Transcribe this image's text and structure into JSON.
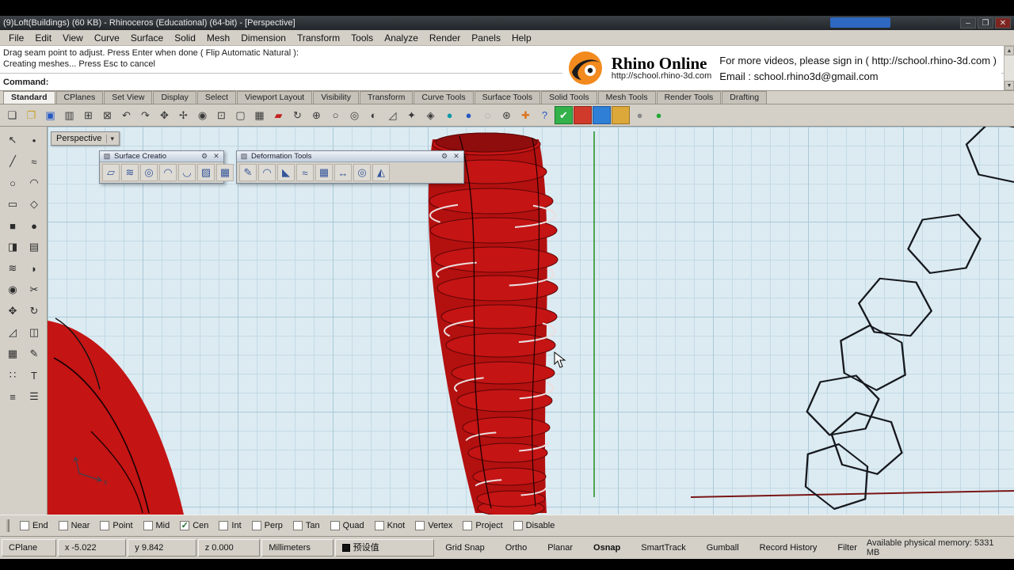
{
  "window": {
    "title": "(9)Loft(Buildings) (60 KB) - Rhinoceros (Educational) (64-bit) - [Perspective]",
    "minimize": "–",
    "maximize": "❐",
    "close": "✕"
  },
  "menu_bar": {
    "items": [
      {
        "name": "menu-file",
        "label": "File"
      },
      {
        "name": "menu-edit",
        "label": "Edit"
      },
      {
        "name": "menu-view",
        "label": "View"
      },
      {
        "name": "menu-curve",
        "label": "Curve"
      },
      {
        "name": "menu-surface",
        "label": "Surface"
      },
      {
        "name": "menu-solid",
        "label": "Solid"
      },
      {
        "name": "menu-mesh",
        "label": "Mesh"
      },
      {
        "name": "menu-dimension",
        "label": "Dimension"
      },
      {
        "name": "menu-transform",
        "label": "Transform"
      },
      {
        "name": "menu-tools",
        "label": "Tools"
      },
      {
        "name": "menu-analyze",
        "label": "Analyze"
      },
      {
        "name": "menu-render",
        "label": "Render"
      },
      {
        "name": "menu-panels",
        "label": "Panels"
      },
      {
        "name": "menu-help",
        "label": "Help"
      }
    ]
  },
  "command_area": {
    "history_line1": "Drag seam point to adjust. Press Enter when done ( Flip  Automatic  Natural ):",
    "history_line2": "Creating meshes... Press Esc to cancel",
    "prompt_label": "Command:",
    "scroll_up": "▲",
    "scroll_down": "▼"
  },
  "ad_banner": {
    "brand": "Rhino Online",
    "brand_url": "http://school.rhino-3d.com",
    "message": "For more videos, please  sign in ( http://school.rhino-3d.com )",
    "email_line": "Email : school.rhino3d@gmail.com"
  },
  "toolbar_tabs": {
    "items": [
      {
        "name": "tab-standard",
        "label": "Standard",
        "active": true
      },
      {
        "name": "tab-cplanes",
        "label": "CPlanes"
      },
      {
        "name": "tab-set-view",
        "label": "Set View"
      },
      {
        "name": "tab-display",
        "label": "Display"
      },
      {
        "name": "tab-select",
        "label": "Select"
      },
      {
        "name": "tab-viewport-layout",
        "label": "Viewport Layout"
      },
      {
        "name": "tab-visibility",
        "label": "Visibility"
      },
      {
        "name": "tab-transform",
        "label": "Transform"
      },
      {
        "name": "tab-curve-tools",
        "label": "Curve Tools"
      },
      {
        "name": "tab-surface-tools",
        "label": "Surface Tools"
      },
      {
        "name": "tab-solid-tools",
        "label": "Solid Tools"
      },
      {
        "name": "tab-mesh-tools",
        "label": "Mesh Tools"
      },
      {
        "name": "tab-render-tools",
        "label": "Render Tools"
      },
      {
        "name": "tab-drafting",
        "label": "Drafting"
      }
    ]
  },
  "main_toolbar": {
    "icons": [
      {
        "name": "new-file-icon",
        "glyph": "❏"
      },
      {
        "name": "open-file-icon",
        "glyph": "❐",
        "variant": "yellow"
      },
      {
        "name": "save-icon",
        "glyph": "▣",
        "variant": "blue"
      },
      {
        "name": "print-icon",
        "glyph": "▥"
      },
      {
        "name": "copy-icon",
        "glyph": "⊞"
      },
      {
        "name": "paste-icon",
        "glyph": "⊠"
      },
      {
        "name": "undo-icon",
        "glyph": "↶"
      },
      {
        "name": "redo-icon",
        "glyph": "↷"
      },
      {
        "name": "pan-icon",
        "glyph": "✥"
      },
      {
        "name": "move-icon",
        "glyph": "✢"
      },
      {
        "name": "zoom-dynamic-icon",
        "glyph": "◉"
      },
      {
        "name": "zoom-window-icon",
        "glyph": "⊡"
      },
      {
        "name": "zoom-extents-icon",
        "glyph": "▢"
      },
      {
        "name": "zoom-selected-icon",
        "glyph": "▦"
      },
      {
        "name": "named-view-icon",
        "glyph": "▰",
        "variant": "red"
      },
      {
        "name": "rotate-view-icon",
        "glyph": "↻"
      },
      {
        "name": "copy-object-icon",
        "glyph": "⊕"
      },
      {
        "name": "circle-tool-icon",
        "glyph": "○"
      },
      {
        "name": "spiral-tool-icon",
        "glyph": "◎"
      },
      {
        "name": "shade-icon",
        "glyph": "◐"
      },
      {
        "name": "scale-icon",
        "glyph": "◿"
      },
      {
        "name": "key-icon",
        "glyph": "✦"
      },
      {
        "name": "lock-icon",
        "glyph": "◈"
      },
      {
        "name": "render-icon",
        "glyph": "●",
        "variant": "teal"
      },
      {
        "name": "render-preview-icon",
        "glyph": "●",
        "variant": "blue"
      },
      {
        "name": "wireframe-icon",
        "glyph": "◌",
        "variant": "gray"
      },
      {
        "name": "settings-icon",
        "glyph": "⊛"
      },
      {
        "name": "add-icon",
        "glyph": "✚",
        "variant": "orange"
      },
      {
        "name": "help-icon",
        "glyph": "?",
        "variant": "blue"
      },
      {
        "name": "check-tile-icon",
        "glyph": "✔",
        "variant": "green-tile"
      },
      {
        "name": "red-tile-icon",
        "glyph": " ",
        "variant": "red-tile"
      },
      {
        "name": "blue-tile-icon",
        "glyph": " ",
        "variant": "blue-tile"
      },
      {
        "name": "amber-tile-icon",
        "glyph": " ",
        "variant": "amber-tile"
      },
      {
        "name": "gray-ball-icon",
        "glyph": "●",
        "variant": "gray"
      },
      {
        "name": "green-ball-icon",
        "glyph": "●",
        "variant": "green"
      }
    ]
  },
  "side_toolbar": {
    "icons": [
      {
        "name": "select-arrow-icon",
        "glyph": "↖"
      },
      {
        "name": "point-icon",
        "glyph": "•"
      },
      {
        "name": "line-icon",
        "glyph": "╱"
      },
      {
        "name": "curve-icon",
        "glyph": "≈"
      },
      {
        "name": "circle-icon",
        "glyph": "○"
      },
      {
        "name": "arc-icon",
        "glyph": "◠"
      },
      {
        "name": "rectangle-icon",
        "glyph": "▭"
      },
      {
        "name": "polygon-icon",
        "glyph": "◇"
      },
      {
        "name": "box-icon",
        "glyph": "■",
        "variant": "blue"
      },
      {
        "name": "sphere-icon",
        "glyph": "●",
        "variant": "blue"
      },
      {
        "name": "extrude-icon",
        "glyph": "◨"
      },
      {
        "name": "surface-icon",
        "glyph": "▤"
      },
      {
        "name": "loft-icon",
        "glyph": "≋"
      },
      {
        "name": "fillet-icon",
        "glyph": "◗",
        "variant": "red"
      },
      {
        "name": "boolean-icon",
        "glyph": "◉",
        "variant": "gray"
      },
      {
        "name": "trim-icon",
        "glyph": "✂"
      },
      {
        "name": "move-object-icon",
        "glyph": "✥"
      },
      {
        "name": "rotate-object-icon",
        "glyph": "↻"
      },
      {
        "name": "scale-object-icon",
        "glyph": "◿"
      },
      {
        "name": "mirror-icon",
        "glyph": "◫"
      },
      {
        "name": "array-icon",
        "glyph": "▦"
      },
      {
        "name": "curve-edit-icon",
        "glyph": "✎"
      },
      {
        "name": "control-points-icon",
        "glyph": "∷"
      },
      {
        "name": "text-icon",
        "glyph": "T"
      },
      {
        "name": "layers-icon",
        "glyph": "≡"
      },
      {
        "name": "properties-icon",
        "glyph": "☰"
      }
    ]
  },
  "viewport": {
    "view_label": "Perspective",
    "dropdown_arrow": "▾"
  },
  "palettes": {
    "surface": {
      "panel_icon": "▨",
      "title": "Surface Creatio",
      "gear": "⚙",
      "close": "✕",
      "overflow": "»",
      "icons": [
        {
          "name": "srf-3pt-icon",
          "glyph": "▱"
        },
        {
          "name": "loft-tool-icon",
          "glyph": "≋"
        },
        {
          "name": "revolve-icon",
          "glyph": "◎"
        },
        {
          "name": "sweep1-icon",
          "glyph": "◠"
        },
        {
          "name": "sweep2-icon",
          "glyph": "◡"
        },
        {
          "name": "patch-icon",
          "glyph": "▨"
        },
        {
          "name": "network-srf-icon",
          "glyph": "▦"
        }
      ]
    },
    "deformation": {
      "panel_icon": "▧",
      "title": "Deformation Tools",
      "gear": "⚙",
      "close": "✕",
      "icons": [
        {
          "name": "udt-pencil-icon",
          "glyph": "✎"
        },
        {
          "name": "bend-icon",
          "glyph": "◠"
        },
        {
          "name": "taper-icon",
          "glyph": "◣"
        },
        {
          "name": "flow-icon",
          "glyph": "≈"
        },
        {
          "name": "cage-edit-icon",
          "glyph": "▦"
        },
        {
          "name": "stretch-icon",
          "glyph": "↔"
        },
        {
          "name": "maelstrom-icon",
          "glyph": "◎"
        },
        {
          "name": "splop-icon",
          "glyph": "◭"
        }
      ]
    }
  },
  "osnap_bar": {
    "items": [
      {
        "name": "osnap-end",
        "label": "End",
        "checked": ""
      },
      {
        "name": "osnap-near",
        "label": "Near",
        "checked": ""
      },
      {
        "name": "osnap-point",
        "label": "Point",
        "checked": ""
      },
      {
        "name": "osnap-mid",
        "label": "Mid",
        "checked": ""
      },
      {
        "name": "osnap-cen",
        "label": "Cen",
        "checked": "✓"
      },
      {
        "name": "osnap-int",
        "label": "Int",
        "checked": ""
      },
      {
        "name": "osnap-perp",
        "label": "Perp",
        "checked": ""
      },
      {
        "name": "osnap-tan",
        "label": "Tan",
        "checked": ""
      },
      {
        "name": "osnap-quad",
        "label": "Quad",
        "checked": ""
      },
      {
        "name": "osnap-knot",
        "label": "Knot",
        "checked": ""
      },
      {
        "name": "osnap-vertex",
        "label": "Vertex",
        "checked": ""
      },
      {
        "name": "osnap-project",
        "label": "Project",
        "checked": ""
      },
      {
        "name": "osnap-disable",
        "label": "Disable",
        "checked": ""
      }
    ]
  },
  "status_bar": {
    "cplane": "CPlane",
    "x": "x -5.022",
    "y": "y 9.842",
    "z": "z 0.000",
    "units": "Millimeters",
    "layer_name": "预设值",
    "toggles": [
      {
        "name": "toggle-grid-snap",
        "label": "Grid Snap"
      },
      {
        "name": "toggle-ortho",
        "label": "Ortho"
      },
      {
        "name": "toggle-planar",
        "label": "Planar"
      },
      {
        "name": "toggle-osnap",
        "label": "Osnap",
        "bold": true
      },
      {
        "name": "toggle-smarttrack",
        "label": "SmartTrack"
      },
      {
        "name": "toggle-gumball",
        "label": "Gumball"
      },
      {
        "name": "toggle-record-history",
        "label": "Record History"
      },
      {
        "name": "toggle-filter",
        "label": "Filter"
      }
    ],
    "memory": "Available physical memory: 5331 MB"
  },
  "colors": {
    "viewport_bg": "#dcebf2",
    "grid_line": "#a9c9d8",
    "object_red": "#c41414",
    "axis_green": "#1f8f1f",
    "axis_red": "#7a1515",
    "hexagon_stroke": "#15181d",
    "green_tile": "#33b14a",
    "red_tile": "#d03a2a",
    "blue_tile": "#2f7fd6",
    "amber_tile": "#dca83a"
  }
}
